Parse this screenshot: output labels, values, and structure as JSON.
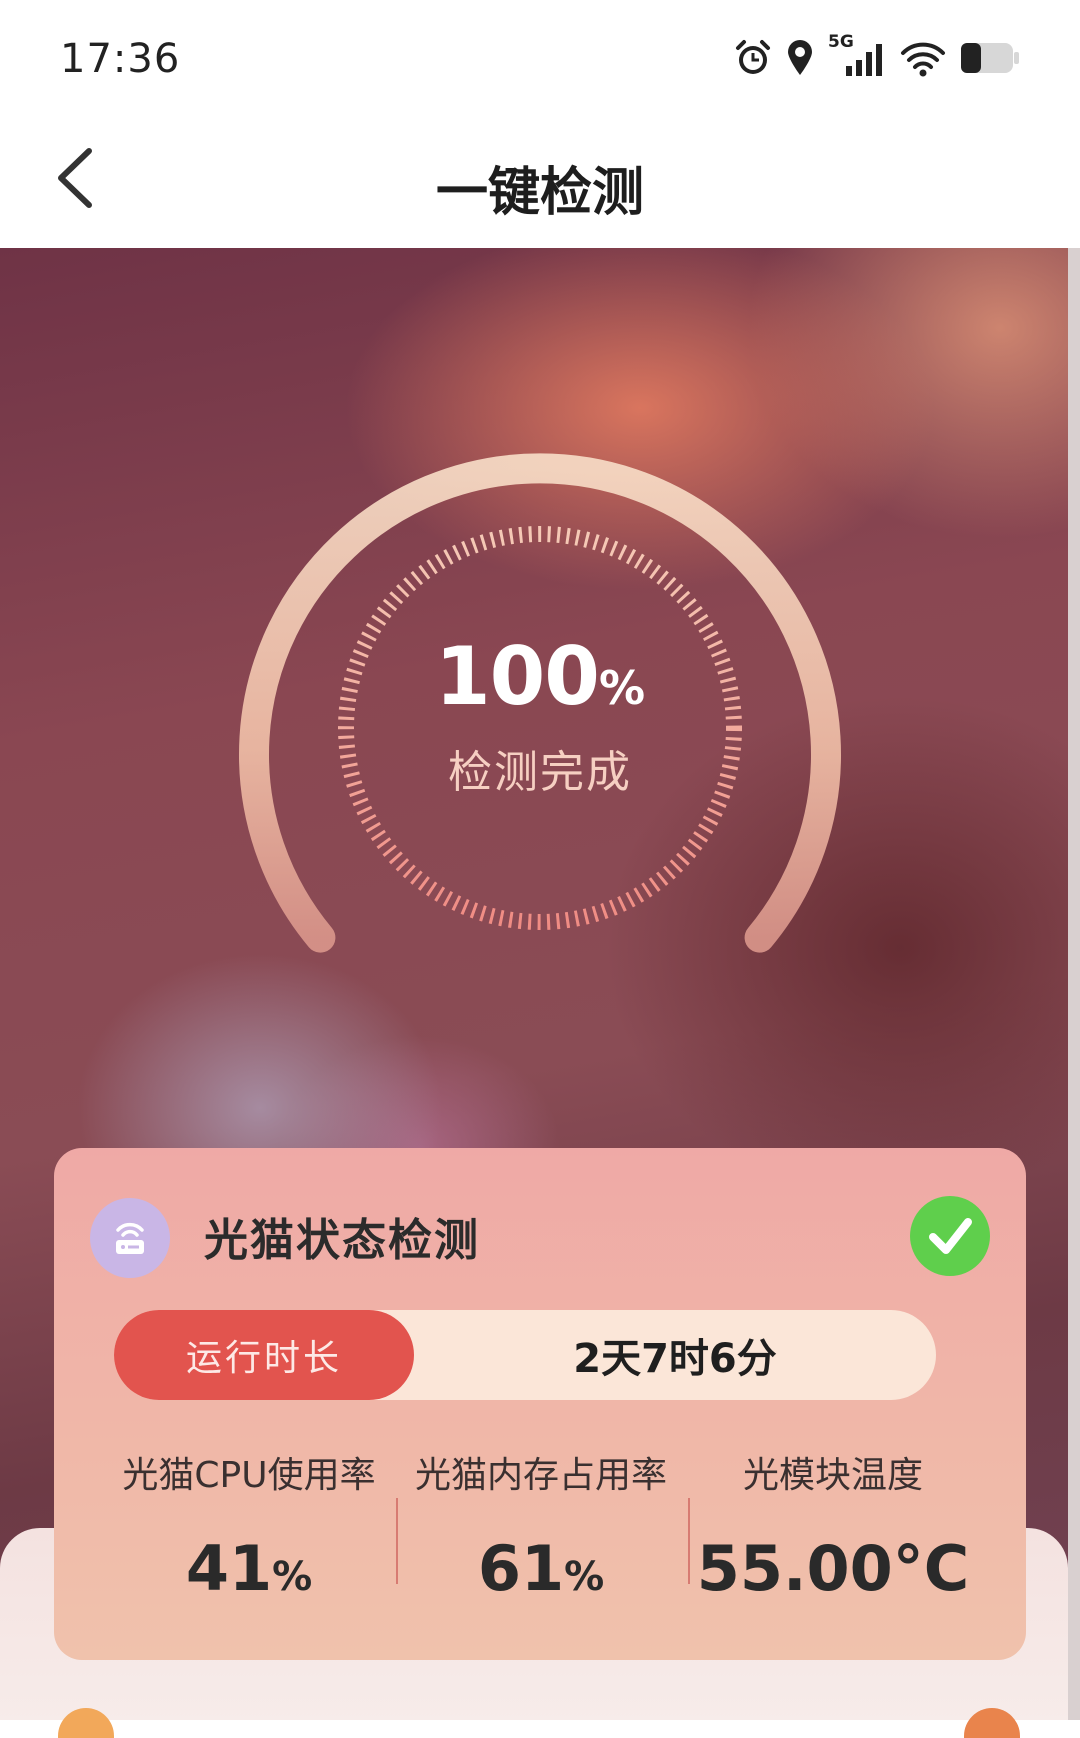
{
  "status_bar": {
    "time": "17:36",
    "network_type": "5G",
    "icons": [
      "alarm-icon",
      "location-icon",
      "signal-icon",
      "wifi-icon",
      "battery-icon"
    ]
  },
  "header": {
    "back_icon": "chevron-left-icon",
    "title": "一键检测"
  },
  "progress": {
    "value": "100",
    "unit": "%",
    "status": "检测完成"
  },
  "card": {
    "icon": "router-icon",
    "title": "光猫状态检测",
    "status_icon": "check-icon",
    "runtime_label": "运行时长",
    "runtime_value": "2天7时6分",
    "metrics": [
      {
        "label": "光猫CPU使用率",
        "value": "41",
        "unit": "%"
      },
      {
        "label": "光猫内存占用率",
        "value": "61",
        "unit": "%"
      },
      {
        "label": "光模块温度",
        "value": "55.00°C",
        "unit": ""
      }
    ]
  },
  "colors": {
    "accent_red": "#e2544e",
    "check_green": "#5fcf4c",
    "card_bg": "#efa9a6"
  }
}
